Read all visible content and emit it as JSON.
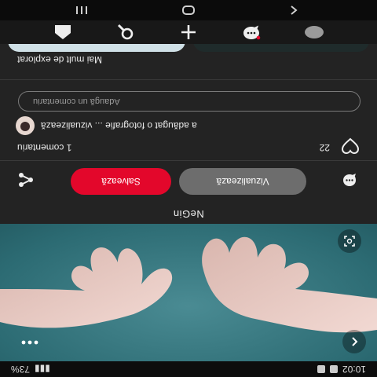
{
  "status_bar": {
    "time": "10:02",
    "battery": "73%",
    "signal": "4G",
    "icons": [
      "alarm-icon",
      "sim-icon"
    ]
  },
  "pin": {
    "title": "NeGin",
    "image_alt": "hands reaching toward each other on teal background"
  },
  "actions": {
    "view_label": "Vizualizează",
    "save_label": "Salvează",
    "share_icon": "share-icon",
    "comment_icon": "comment-icon"
  },
  "comments": {
    "count_label": "1 comentariu",
    "likes": "22",
    "preview_text": "a adăugat o fotografie ... vizualizează",
    "input_placeholder": "Adaugă un comentariu"
  },
  "explore": {
    "title": "Mai mult de explorat"
  },
  "bottom_nav": [
    "home",
    "search",
    "create",
    "messages",
    "profile"
  ],
  "system_nav": [
    "recent",
    "home",
    "back"
  ],
  "colors": {
    "accent_red": "#e3072b",
    "background": "#232323",
    "pill_gray": "#6d6d6d"
  }
}
